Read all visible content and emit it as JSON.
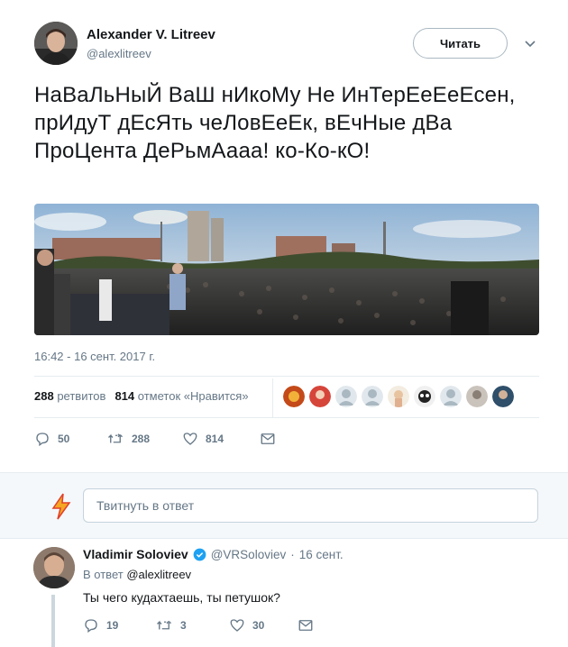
{
  "tweet": {
    "author_name": "Alexander V. Litreev",
    "author_handle": "@alexlitreev",
    "follow_label": "Читать",
    "text": "НаВаЛьНыЙ ВаШ нИкоМу Не ИнТерЕеЕеЕсен, прИдуТ дЕсЯть чеЛовЕеЕк, вЕчНые дВа ПроЦента ДеРьмАааа! ко-Ко-кО!",
    "timestamp": "16:42 - 16 сент. 2017 г.",
    "retweets_count": "288",
    "retweets_label": "ретвитов",
    "likes_count": "814",
    "likes_label": "отметок «Нравится»",
    "actions": {
      "reply_count": "50",
      "retweet_count": "288",
      "like_count": "814"
    }
  },
  "reply_box": {
    "placeholder": "Твитнуть в ответ"
  },
  "reply": {
    "author_name": "Vladimir Soloviev",
    "author_handle": "@VRSoloviev",
    "dot": "·",
    "date": "16 сент.",
    "replying_prefix": "В ответ",
    "replying_to": "@alexlitreev",
    "text": "Ты чего кудахтаешь, ты петушок?",
    "actions": {
      "reply_count": "19",
      "retweet_count": "3",
      "like_count": "30"
    }
  },
  "colors": {
    "accent": "#1da1f2",
    "muted": "#657786",
    "text": "#14171a",
    "verified": "#1da1f2"
  }
}
